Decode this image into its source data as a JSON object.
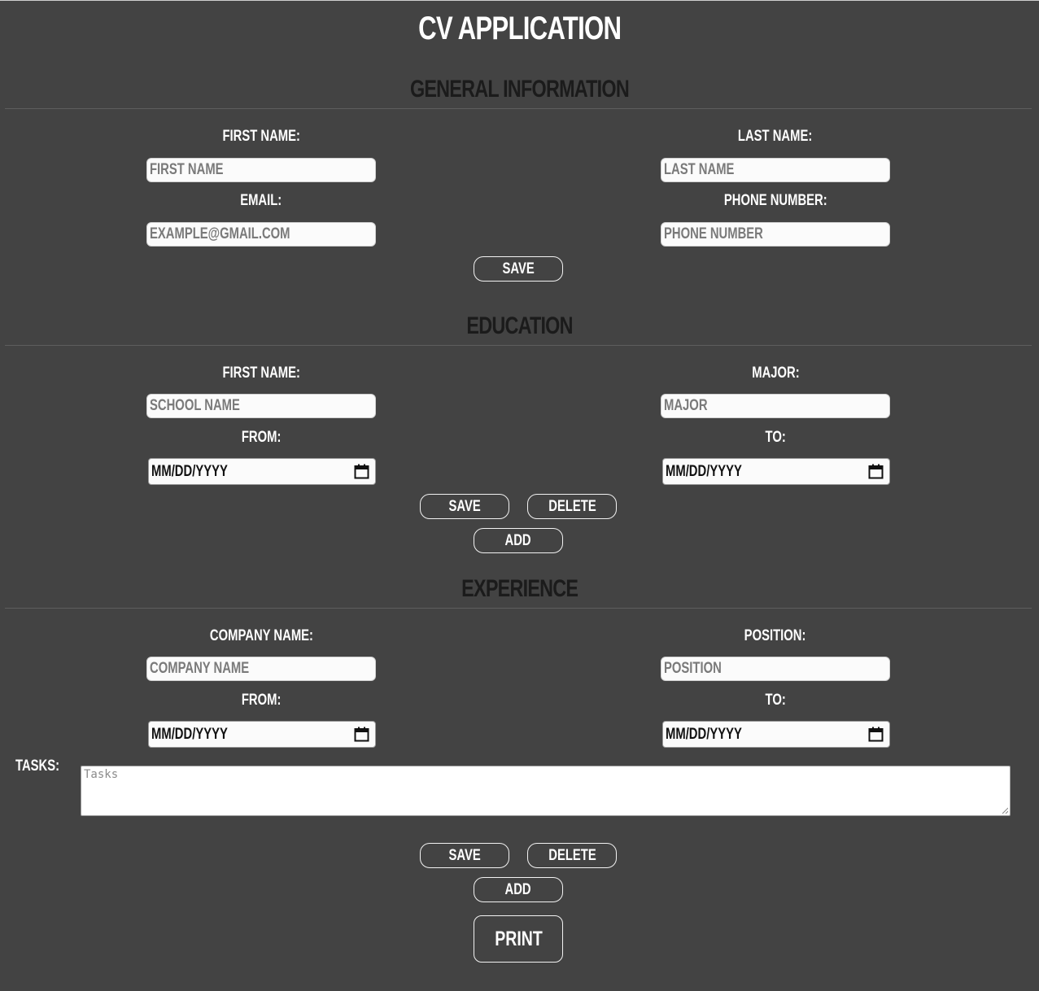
{
  "app": {
    "title": "CV APPLICATION"
  },
  "general": {
    "title": "GENERAL INFORMATION",
    "first_name_label": "FIRST NAME:",
    "first_name_placeholder": "FIRST NAME",
    "last_name_label": "LAST NAME:",
    "last_name_placeholder": "LAST NAME",
    "email_label": "EMAIL:",
    "email_placeholder": "EXAMPLE@GMAIL.COM",
    "phone_label": "PHONE NUMBER:",
    "phone_placeholder": "PHONE NUMBER",
    "save_label": "SAVE"
  },
  "education": {
    "title": "EDUCATION",
    "school_label": "FIRST NAME:",
    "school_placeholder": "SCHOOL NAME",
    "major_label": "MAJOR:",
    "major_placeholder": "MAJOR",
    "from_label": "FROM:",
    "from_value": "MM/DD/YYYY",
    "to_label": "TO:",
    "to_value": "MM/DD/YYYY",
    "save_label": "SAVE",
    "delete_label": "DELETE",
    "add_label": "ADD"
  },
  "experience": {
    "title": "EXPERIENCE",
    "company_label": "COMPANY NAME:",
    "company_placeholder": "COMPANY NAME",
    "position_label": "POSITION:",
    "position_placeholder": "POSITION",
    "from_label": "FROM:",
    "from_value": "MM/DD/YYYY",
    "to_label": "TO:",
    "to_value": "MM/DD/YYYY",
    "tasks_label": "TASKS:",
    "tasks_placeholder": "Tasks",
    "save_label": "SAVE",
    "delete_label": "DELETE",
    "add_label": "ADD"
  },
  "print_label": "PRINT",
  "icons": {
    "date_picker": "calendar-icon",
    "resize": "resize-grip-icon"
  }
}
